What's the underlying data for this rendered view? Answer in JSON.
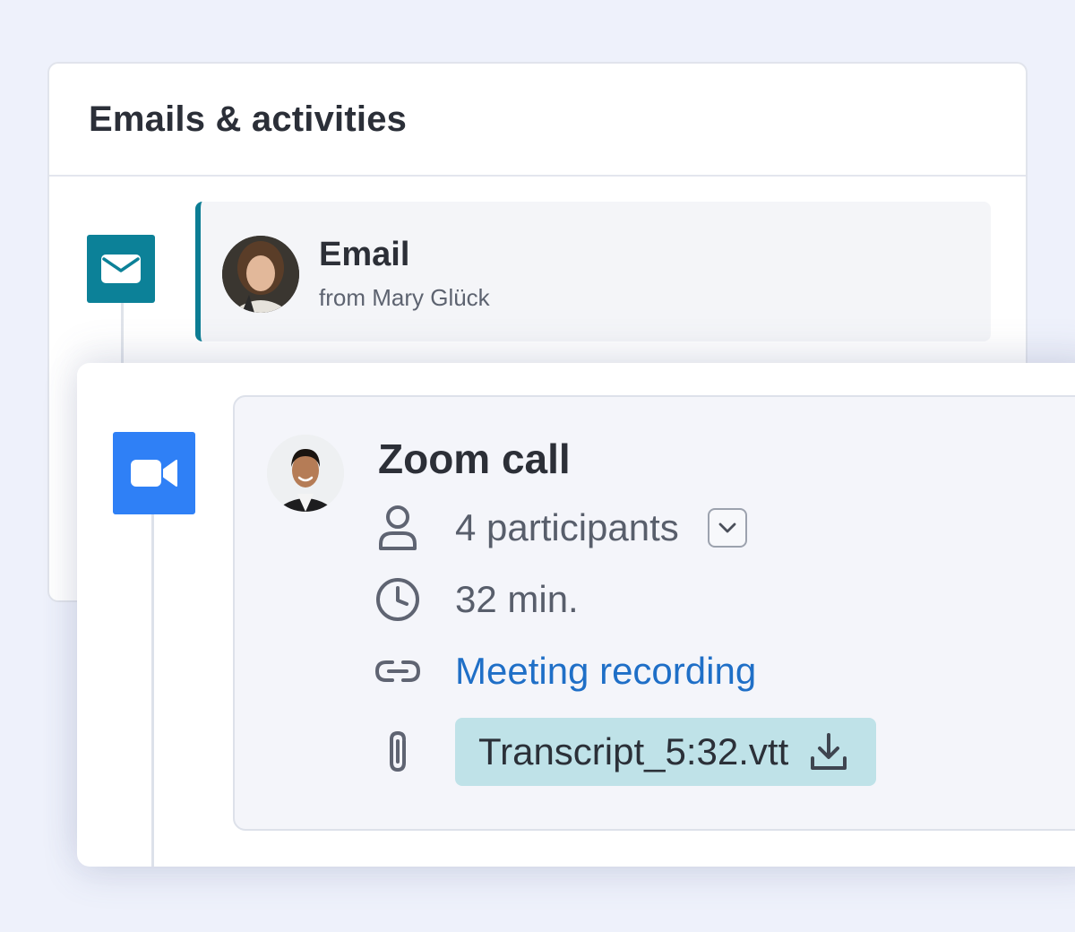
{
  "activities_panel": {
    "title": "Emails & activities"
  },
  "email_activity": {
    "type_icon": "envelope-icon",
    "title": "Email",
    "subtitle": "from Mary Glück",
    "accent_color": "#0c7d94"
  },
  "zoom_activity": {
    "type_icon": "video-camera-icon",
    "title": "Zoom call",
    "participants": "4 participants",
    "duration": "32 min.",
    "recording_link": "Meeting recording",
    "transcript_file": "Transcript_5:32.vtt",
    "accent_color": "#2f80f6"
  }
}
